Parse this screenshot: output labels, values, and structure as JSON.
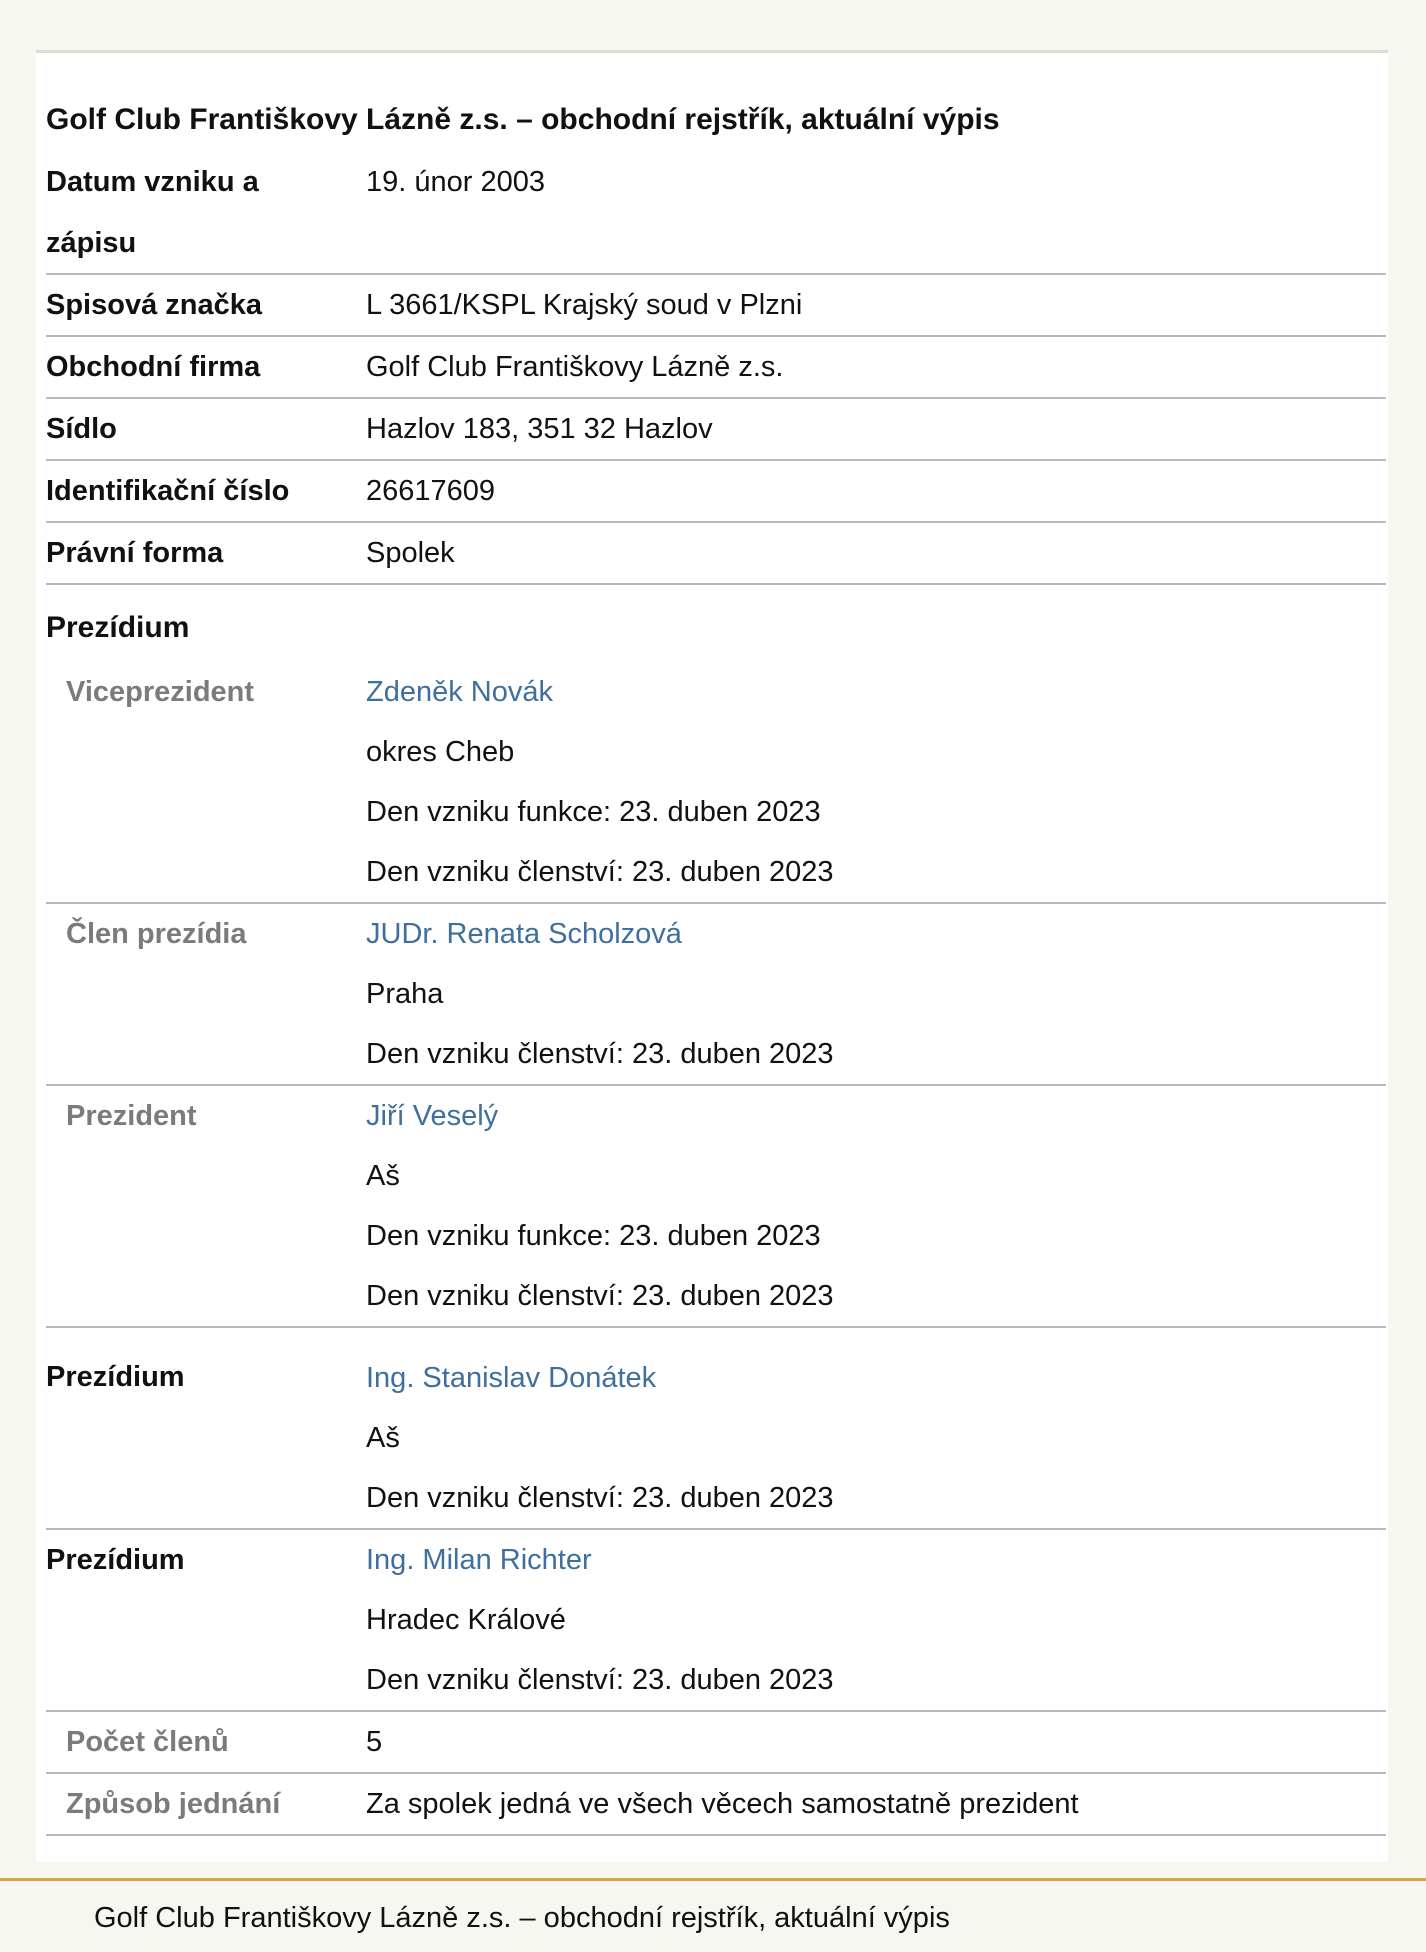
{
  "heading": "Golf Club Františkovy Lázně z.s. – obchodní rejstřík, aktuální výpis",
  "basic": {
    "datum_label": "Datum vzniku a zápisu",
    "datum_value": "19. únor 2003",
    "spisova_label": "Spisová značka",
    "spisova_value": "L 3661/KSPL Krajský soud v Plzni",
    "firma_label": "Obchodní firma",
    "firma_value": "Golf Club Františkovy Lázně z.s.",
    "sidlo_label": "Sídlo",
    "sidlo_value": "Hazlov 183, 351 32 Hazlov",
    "ico_label": "Identifikační číslo",
    "ico_value": "26617609",
    "forma_label": "Právní forma",
    "forma_value": "Spolek"
  },
  "prezidium": {
    "section_title": "Prezídium",
    "members": [
      {
        "role": "Viceprezident",
        "name": "Zdeněk Novák",
        "place": "okres Cheb",
        "funkce": "Den vzniku funkce: 23. duben 2023",
        "clenstvi": "Den vzniku členství: 23. duben 2023"
      },
      {
        "role": "Člen prezídia",
        "name": "JUDr. Renata Scholzová",
        "place": "Praha",
        "clenstvi": "Den vzniku členství: 23. duben 2023"
      },
      {
        "role": "Prezident",
        "name": "Jiří Veselý",
        "place": "Aš",
        "funkce": "Den vzniku funkce: 23. duben 2023",
        "clenstvi": "Den vzniku členství: 23. duben 2023"
      }
    ],
    "other": [
      {
        "label": "Prezídium",
        "name": "Ing. Stanislav Donátek",
        "place": "Aš",
        "clenstvi": "Den vzniku členství: 23. duben 2023"
      },
      {
        "label": "Prezídium",
        "name": "Ing. Milan Richter",
        "place": "Hradec Králové",
        "clenstvi": "Den vzniku členství: 23. duben 2023"
      }
    ],
    "pocet_label": "Počet členů",
    "pocet_value": "5",
    "zpusob_label": "Způsob jednání",
    "zpusob_value": "Za spolek jedná ve všech věcech samostatně prezident"
  },
  "footer": "Golf Club Františkovy Lázně z.s. – obchodní rejstřík, aktuální výpis"
}
